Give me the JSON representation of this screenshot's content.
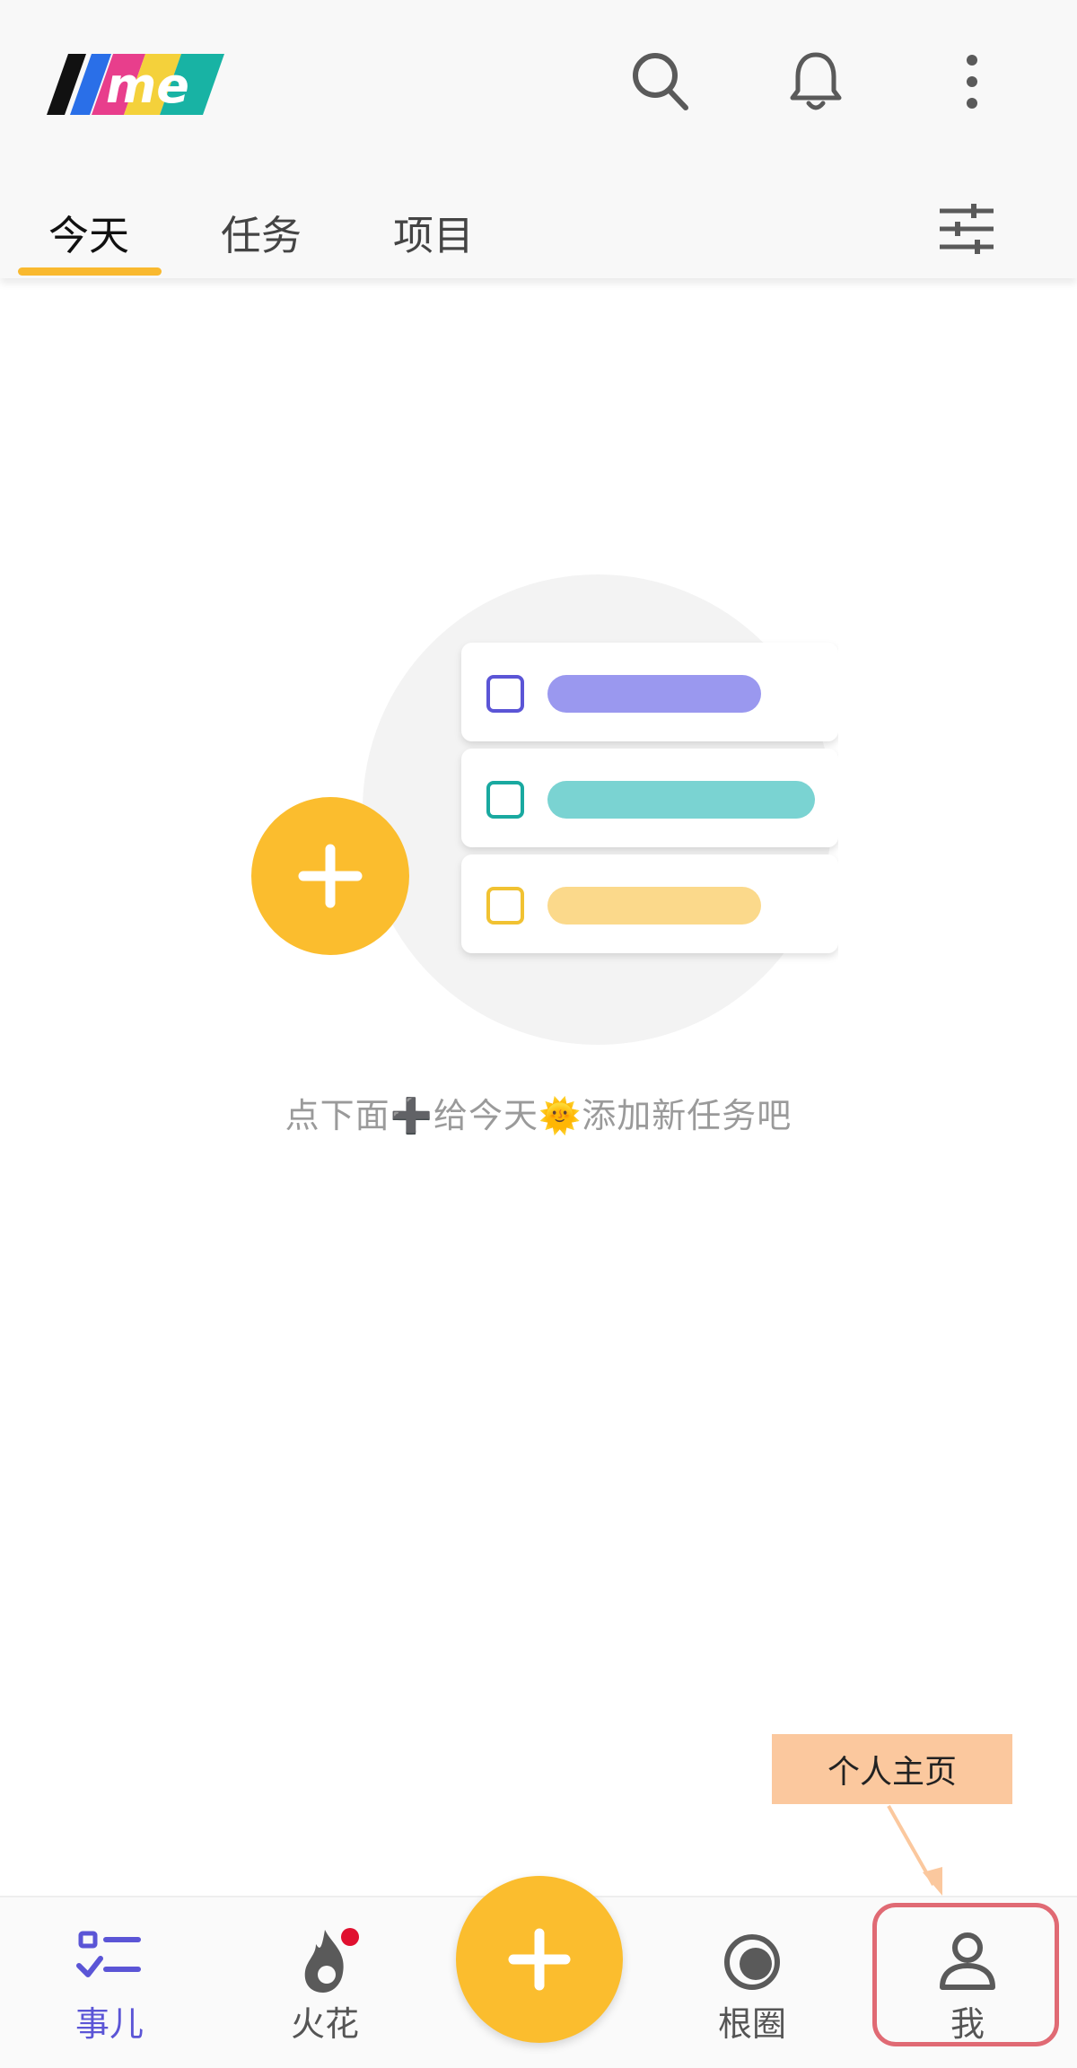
{
  "header": {
    "logo_text": "me",
    "icons": [
      "search-icon",
      "bell-icon",
      "more-vert-icon",
      "filter-sliders-icon"
    ]
  },
  "tabs": [
    {
      "label": "今天",
      "active": true
    },
    {
      "label": "任务",
      "active": false
    },
    {
      "label": "项目",
      "active": false
    }
  ],
  "empty_state": {
    "message": "点下面➕给今天🌞添加新任务吧"
  },
  "callout": {
    "text": "个人主页"
  },
  "bottom_nav": {
    "items": [
      {
        "label": "事儿",
        "icon": "task-list-icon",
        "active": true
      },
      {
        "label": "火花",
        "icon": "flame-icon",
        "active": false
      },
      {
        "label": "根圈",
        "icon": "circle-ring-icon",
        "active": false
      },
      {
        "label": "我",
        "icon": "person-icon",
        "active": false
      }
    ],
    "fab_icon": "plus-icon"
  },
  "colors": {
    "accent": "#fbbd2e",
    "active": "#5b55d6",
    "highlight": "#e06a74",
    "callout_bg": "#fbc89e"
  }
}
